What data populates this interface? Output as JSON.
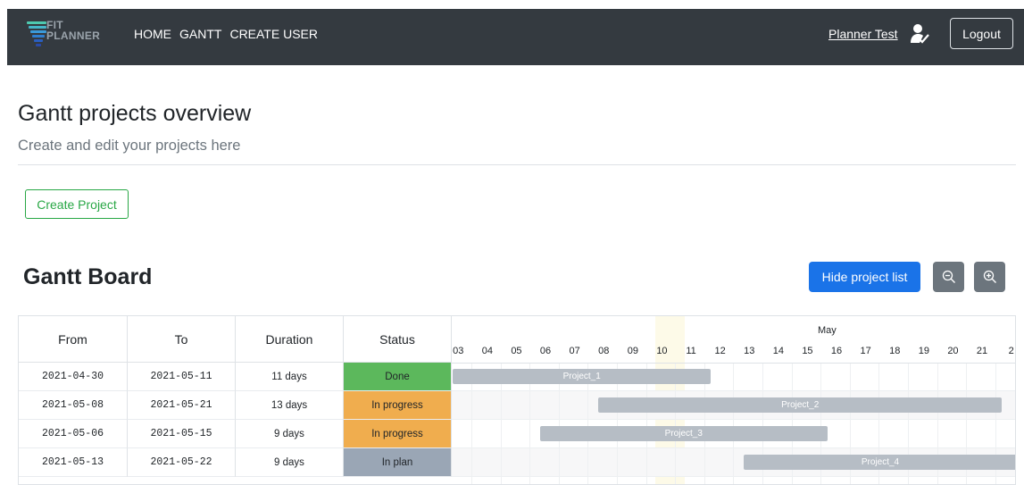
{
  "navbar": {
    "logo": {
      "line1": "FIT",
      "line2": "PLANNER"
    },
    "links": [
      "HOME",
      "GANTT",
      "CREATE USER"
    ],
    "user_name": "Planner Test",
    "logout_label": "Logout"
  },
  "header": {
    "title": "Gantt projects overview",
    "subtitle": "Create and edit your projects here",
    "create_label": "Create Project"
  },
  "board": {
    "title": "Gantt Board",
    "hide_label": "Hide project list",
    "columns": [
      "From",
      "To",
      "Duration",
      "Status"
    ],
    "month": "May",
    "days": [
      "03",
      "04",
      "05",
      "06",
      "07",
      "08",
      "09",
      "10",
      "11",
      "12",
      "13",
      "14",
      "15",
      "16",
      "17",
      "18",
      "19",
      "20",
      "21",
      "2"
    ],
    "rows": [
      {
        "from": "2021-04-30",
        "to": "2021-05-11",
        "duration": "11 days",
        "status": "Done",
        "status_color": "#5cb85c",
        "project": "Project_1"
      },
      {
        "from": "2021-05-08",
        "to": "2021-05-21",
        "duration": "13 days",
        "status": "In progress",
        "status_color": "#f0ad4e",
        "project": "Project_2"
      },
      {
        "from": "2021-05-06",
        "to": "2021-05-15",
        "duration": "9 days",
        "status": "In progress",
        "status_color": "#f0ad4e",
        "project": "Project_3"
      },
      {
        "from": "2021-05-13",
        "to": "2021-05-22",
        "duration": "9 days",
        "status": "In plan",
        "status_color": "#9aa6b5",
        "project": "Project_4"
      }
    ]
  },
  "colors": {
    "navbar": "#343a40",
    "primary": "#1a73e8",
    "success": "#28a745",
    "secondary": "#6c757d",
    "bar": "#b6bdc5"
  }
}
